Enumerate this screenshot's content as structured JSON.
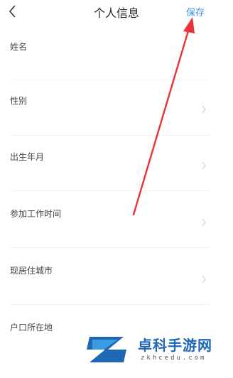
{
  "header": {
    "title": "个人信息",
    "back_icon": "chevron-left-icon",
    "save_label": "保存",
    "save_color": "#3a8ee6"
  },
  "fields": [
    {
      "label": "姓名",
      "has_chevron": false
    },
    {
      "label": "性别",
      "has_chevron": true
    },
    {
      "label": "出生年月",
      "has_chevron": true
    },
    {
      "label": "参加工作时间",
      "has_chevron": true
    },
    {
      "label": "现居住城市",
      "has_chevron": true
    },
    {
      "label": "户口所在地",
      "has_chevron": false
    }
  ],
  "annotation": {
    "arrow_color": "#e8333b"
  },
  "watermark": {
    "title": "卓科手游网",
    "subtitle": "zkhcedu.com",
    "color": "#1f68b4"
  }
}
